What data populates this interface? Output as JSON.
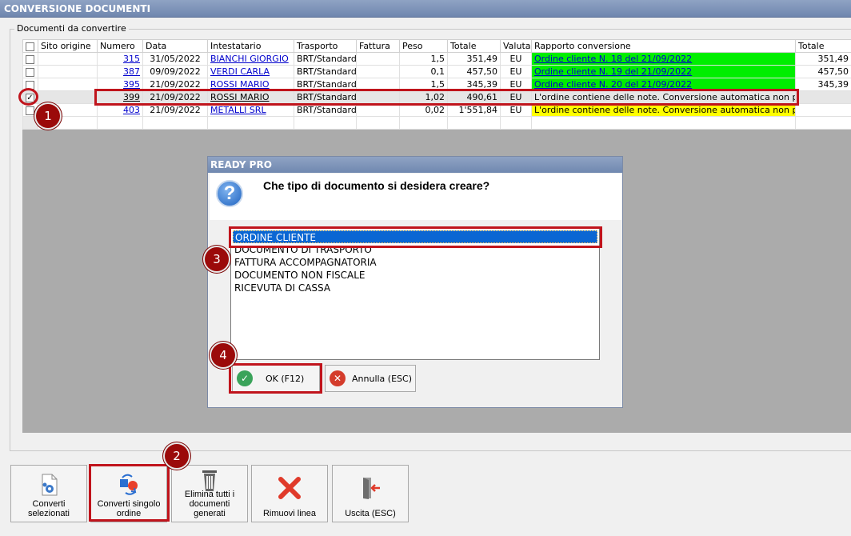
{
  "window": {
    "title": "CONVERSIONE DOCUMENTI"
  },
  "group": {
    "label": "Documenti da convertire"
  },
  "grid": {
    "columns": [
      "Sito origine",
      "Numero",
      "Data",
      "Intestatario",
      "Trasporto",
      "Fattura",
      "Peso",
      "Totale",
      "Valuta",
      "Rapporto conversione",
      "Totale"
    ],
    "rows": [
      {
        "checked": false,
        "sito": "",
        "numero": "315",
        "data": "31/05/2022",
        "intestatario": "BIANCHI GIORGIO",
        "trasporto": "BRT/Standard",
        "fattura": "",
        "peso": "1,5",
        "totale": "351,49",
        "valuta": "EU",
        "rapporto": "Ordine cliente N. 18 del 21/09/2022",
        "rapporto_color": "green",
        "totale2": "351,49"
      },
      {
        "checked": false,
        "sito": "",
        "numero": "387",
        "data": "09/09/2022",
        "intestatario": "VERDI CARLA",
        "trasporto": "BRT/Standard",
        "fattura": "",
        "peso": "0,1",
        "totale": "457,50",
        "valuta": "EU",
        "rapporto": "Ordine cliente N. 19 del 21/09/2022",
        "rapporto_color": "green",
        "totale2": "457,50"
      },
      {
        "checked": false,
        "sito": "",
        "numero": "395",
        "data": "21/09/2022",
        "intestatario": "ROSSI MARIO",
        "trasporto": "BRT/Standard",
        "fattura": "",
        "peso": "1,5",
        "totale": "345,39",
        "valuta": "EU",
        "rapporto": "Ordine cliente N. 20 del 21/09/2022",
        "rapporto_color": "green",
        "totale2": "345,39"
      },
      {
        "checked": true,
        "sito": "",
        "numero": "399",
        "data": "21/09/2022",
        "intestatario": "ROSSI MARIO",
        "trasporto": "BRT/Standard",
        "fattura": "",
        "peso": "1,02",
        "totale": "490,61",
        "valuta": "EU",
        "rapporto": "L'ordine contiene delle note. Conversione automatica non possibile.",
        "rapporto_color": "none",
        "totale2": ""
      },
      {
        "checked": false,
        "sito": "",
        "numero": "403",
        "data": "21/09/2022",
        "intestatario": "METALLI SRL",
        "trasporto": "BRT/Standard",
        "fattura": "",
        "peso": "0,02",
        "totale": "1'551,84",
        "valuta": "EU",
        "rapporto": "L'ordine contiene delle note. Conversione automatica non possibile.",
        "rapporto_color": "yellow",
        "totale2": ""
      }
    ]
  },
  "dialog": {
    "title": "READY PRO",
    "question": "Che tipo di documento si desidera creare?",
    "options": [
      "ORDINE CLIENTE",
      "DOCUMENTO DI TRASPORTO",
      "FATTURA ACCOMPAGNATORIA",
      "DOCUMENTO NON FISCALE",
      "RICEVUTA DI CASSA"
    ],
    "selected_index": 0,
    "ok_label": "OK (F12)",
    "cancel_label": "Annulla (ESC)"
  },
  "toolbar": {
    "buttons": [
      {
        "label": "Converti selezionati",
        "icon": "document-gear-icon"
      },
      {
        "label": "Converti singolo ordine",
        "icon": "convert-arrows-icon"
      },
      {
        "label": "Elimina tutti i documenti generati",
        "icon": "trash-icon"
      },
      {
        "label": "Rimuovi linea",
        "icon": "red-x-icon"
      },
      {
        "label": "Uscita (ESC)",
        "icon": "exit-door-icon"
      }
    ]
  },
  "annotations": [
    "1",
    "2",
    "3",
    "4"
  ],
  "colors": {
    "accent_red": "#c0141c",
    "badge": "#9b0a0a",
    "title_bar": "#7a8fb8",
    "green_cell": "#00ee00",
    "yellow_cell": "#ffff00",
    "selection": "#0a66d3"
  }
}
